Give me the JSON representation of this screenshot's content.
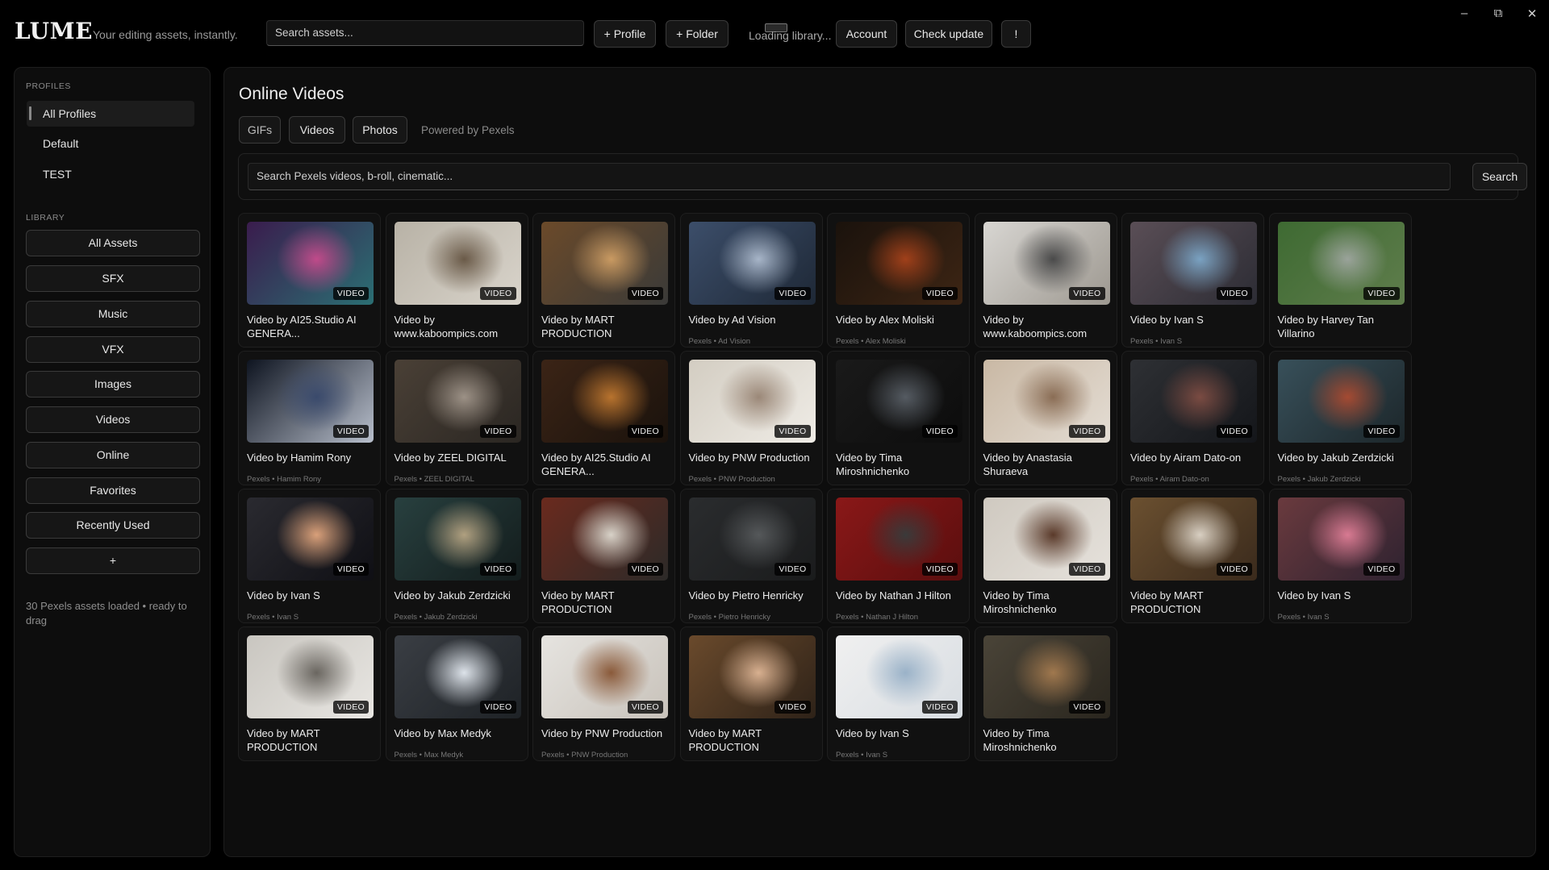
{
  "app": {
    "logo": "LUME",
    "tagline": "Your editing assets, instantly.",
    "search_placeholder": "Search assets...",
    "buttons": {
      "add_profile": "+ Profile",
      "add_folder": "+ Folder",
      "account": "Account",
      "check_update": "Check update",
      "alert": "!"
    },
    "loading_text": "Loading library...",
    "window_controls": {
      "minimize": "–",
      "maximize": "⧉",
      "close": "✕"
    }
  },
  "sidebar": {
    "profiles_title": "PROFILES",
    "profiles": [
      "All Profiles",
      "Default",
      "TEST"
    ],
    "active_profile": "All Profiles",
    "library_title": "LIBRARY",
    "library_items": [
      "All Assets",
      "SFX",
      "Music",
      "VFX",
      "Images",
      "Videos",
      "Online",
      "Favorites",
      "Recently Used",
      "+"
    ],
    "status": "30 Pexels assets loaded • ready to drag"
  },
  "main": {
    "title": "Online Videos",
    "tabs": [
      "GIFs",
      "Videos",
      "Photos"
    ],
    "powered_by": "Powered by Pexels",
    "search_placeholder": "Search Pexels videos, b-roll, cinematic...",
    "search_button": "Search",
    "badge_label": "VIDEO",
    "cards": [
      {
        "title": "Video by AI25.Studio  AI GENERA...",
        "sub": "",
        "colors": [
          "#3a1c4d",
          "#c04a8a",
          "#2b6f73"
        ]
      },
      {
        "title": "Video by www.kaboompics.com",
        "sub": "",
        "colors": [
          "#b8b2a6",
          "#6a5a48",
          "#d9d4cb"
        ]
      },
      {
        "title": "Video by MART PRODUCTION",
        "sub": "",
        "colors": [
          "#6b4a2a",
          "#c99a62",
          "#3a3a38"
        ]
      },
      {
        "title": "Video by Ad Vision",
        "sub": "Pexels • Ad Vision",
        "colors": [
          "#3c4e6a",
          "#a7b5c8",
          "#1e2836"
        ]
      },
      {
        "title": "Video by Alex Moliski",
        "sub": "Pexels • Alex Moliski",
        "colors": [
          "#1a120c",
          "#a0401a",
          "#3d2514"
        ]
      },
      {
        "title": "Video by www.kaboompics.com",
        "sub": "",
        "colors": [
          "#d8d6d2",
          "#4a4a4a",
          "#9d9890"
        ]
      },
      {
        "title": "Video by Ivan S",
        "sub": "Pexels • Ivan S",
        "colors": [
          "#5a4e56",
          "#7aa2c2",
          "#2c2c34"
        ]
      },
      {
        "title": "Video by Harvey Tan Villarino",
        "sub": "",
        "colors": [
          "#3e6a32",
          "#9aa39a",
          "#5f7d4c"
        ]
      },
      {
        "title": "Video by Hamim Rony",
        "sub": "Pexels • Hamim Rony",
        "colors": [
          "#0e1420",
          "#3a4a6c",
          "#b8bfcc"
        ]
      },
      {
        "title": "Video by ZEEL DIGITAL",
        "sub": "Pexels • ZEEL DIGITAL",
        "colors": [
          "#4a4036",
          "#9c9186",
          "#2a2622"
        ]
      },
      {
        "title": "Video by AI25.Studio  AI GENERA...",
        "sub": "",
        "colors": [
          "#3b2416",
          "#b8732e",
          "#1a120c"
        ]
      },
      {
        "title": "Video by PNW Production",
        "sub": "Pexels • PNW Production",
        "colors": [
          "#d3cdc2",
          "#9b8878",
          "#efece6"
        ]
      },
      {
        "title": "Video by Tima Miroshnichenko",
        "sub": "",
        "colors": [
          "#1a1a1a",
          "#555b62",
          "#0c0c0c"
        ]
      },
      {
        "title": "Video by Anastasia Shuraeva",
        "sub": "",
        "colors": [
          "#c9b8a4",
          "#8a6d55",
          "#e4ddd4"
        ]
      },
      {
        "title": "Video by Airam Dato-on",
        "sub": "Pexels • Airam Dato-on",
        "colors": [
          "#2e3034",
          "#7a4b42",
          "#14161a"
        ]
      },
      {
        "title": "Video by Jakub Zerdzicki",
        "sub": "Pexels • Jakub Zerdzicki",
        "colors": [
          "#38505a",
          "#a44a32",
          "#1c262a"
        ]
      },
      {
        "title": "Video by Ivan S",
        "sub": "Pexels • Ivan S",
        "colors": [
          "#2a2a30",
          "#d9a07a",
          "#0f0f14"
        ]
      },
      {
        "title": "Video by Jakub Zerdzicki",
        "sub": "Pexels • Jakub Zerdzicki",
        "colors": [
          "#28403f",
          "#b0a080",
          "#131c1c"
        ]
      },
      {
        "title": "Video by MART PRODUCTION",
        "sub": "",
        "colors": [
          "#6a2a1e",
          "#d8d2c8",
          "#2c2a28"
        ]
      },
      {
        "title": "Video by Pietro Henricky",
        "sub": "Pexels • Pietro Henricky",
        "colors": [
          "#2a2c2e",
          "#55585a",
          "#1a1b1c"
        ]
      },
      {
        "title": "Video by Nathan J Hilton",
        "sub": "Pexels • Nathan J Hilton",
        "colors": [
          "#8a1818",
          "#3a3a3a",
          "#5a0e0e"
        ]
      },
      {
        "title": "Video by Tima Miroshnichenko",
        "sub": "",
        "colors": [
          "#cfc9c0",
          "#5a3a2a",
          "#e6e2dc"
        ]
      },
      {
        "title": "Video by MART PRODUCTION",
        "sub": "",
        "colors": [
          "#6b5030",
          "#d8cfc2",
          "#3a2a1c"
        ]
      },
      {
        "title": "Video by Ivan S",
        "sub": "Pexels • Ivan S",
        "colors": [
          "#6a3a3e",
          "#d87a92",
          "#2e2230"
        ]
      },
      {
        "title": "Video by MART PRODUCTION",
        "sub": "",
        "colors": [
          "#c9c6c0",
          "#6a6660",
          "#e8e6e2"
        ]
      },
      {
        "title": "Video by Max Medyk",
        "sub": "Pexels • Max Medyk",
        "colors": [
          "#3a3e44",
          "#dde3ea",
          "#1e2226"
        ]
      },
      {
        "title": "Video by PNW Production",
        "sub": "Pexels • PNW Production",
        "colors": [
          "#e6e4e0",
          "#8a5a3a",
          "#c8c2ba"
        ]
      },
      {
        "title": "Video by MART PRODUCTION",
        "sub": "",
        "colors": [
          "#6a4a2c",
          "#d8b090",
          "#2e2218"
        ]
      },
      {
        "title": "Video by Ivan S",
        "sub": "Pexels • Ivan S",
        "colors": [
          "#f0f0f0",
          "#9ab2c8",
          "#d8dde2"
        ]
      },
      {
        "title": "Video by Tima Miroshnichenko",
        "sub": "",
        "colors": [
          "#4a4438",
          "#a0784e",
          "#2a261e"
        ]
      }
    ]
  }
}
